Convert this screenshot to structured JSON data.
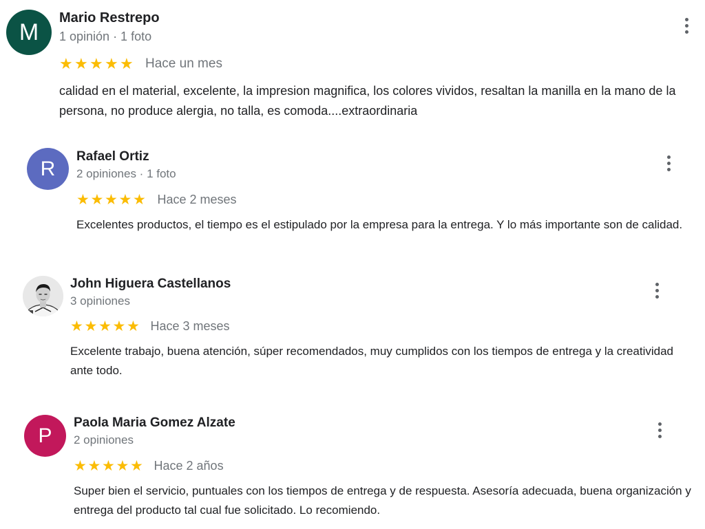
{
  "colors": {
    "star": "#fbbc04",
    "meta_text": "#70757a",
    "body_text": "#202124",
    "avatar_m": "#0b5345",
    "avatar_r": "#5c6bc0",
    "avatar_p": "#c2185b"
  },
  "reviews": [
    {
      "avatar_letter": "M",
      "name": "Mario Restrepo",
      "meta": "1 opinión · 1 foto",
      "rating": 5,
      "stars": "★★★★★",
      "when": "Hace un mes",
      "text": "calidad en el material, excelente, la impresion magnifica, los colores vividos, resaltan la manilla en la mano de la persona, no produce alergia, no talla, es comoda....extraordinaria",
      "menu_icon": "more-vert-icon"
    },
    {
      "avatar_letter": "R",
      "name": "Rafael Ortiz",
      "meta": "2 opiniones · 1 foto",
      "rating": 5,
      "stars": "★★★★★",
      "when": "Hace 2 meses",
      "text": "Excelentes productos, el tiempo es el estipulado por la empresa para la entrega. Y lo más importante son de calidad.",
      "menu_icon": "more-vert-icon"
    },
    {
      "avatar_letter": "",
      "avatar_icon": "profile-photo",
      "name": "John Higuera Castellanos",
      "meta": "3 opiniones",
      "rating": 5,
      "stars": "★★★★★",
      "when": "Hace 3 meses",
      "text": "Excelente trabajo, buena atención, súper  recomendados, muy cumplidos con los tiempos de entrega y la creatividad ante todo.",
      "menu_icon": "more-vert-icon"
    },
    {
      "avatar_letter": "P",
      "name": "Paola Maria Gomez Alzate",
      "meta": "2 opiniones",
      "rating": 5,
      "stars": "★★★★★",
      "when": "Hace 2 años",
      "text": "Super bien el servicio, puntuales con los tiempos de entrega y de respuesta. Asesoría adecuada, buena organización y entrega del producto tal cual fue solicitado. Lo recomiendo.",
      "menu_icon": "more-vert-icon"
    }
  ]
}
